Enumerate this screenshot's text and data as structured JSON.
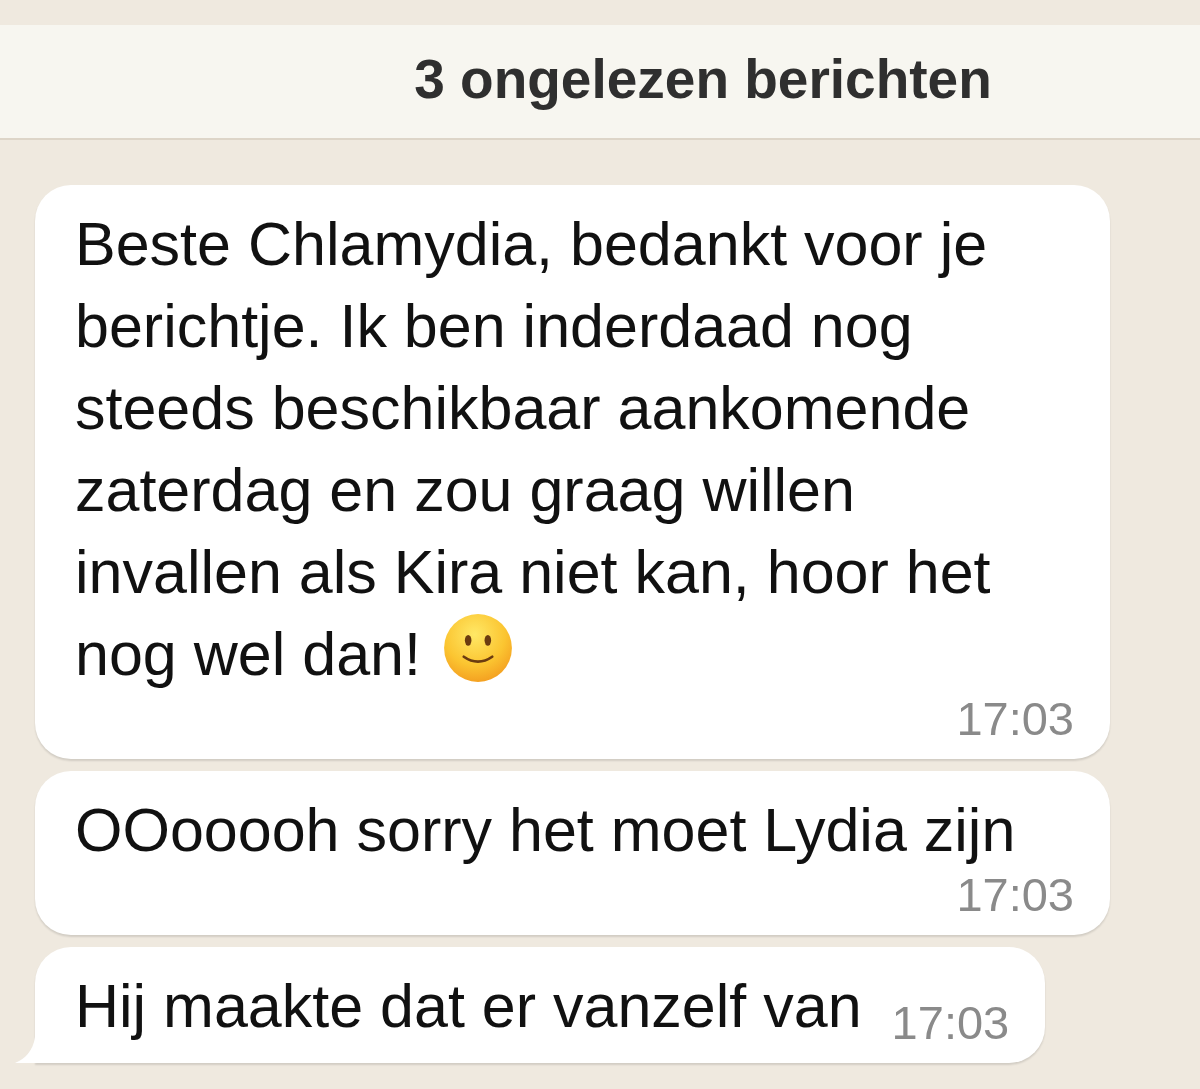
{
  "banner": {
    "text": "3 ongelezen berichten"
  },
  "messages": [
    {
      "text": "Beste Chlamydia, bedankt voor je berichtje. Ik ben inderdaad nog steeds beschikbaar aankomende zaterdag en zou graag willen invallen als Kira niet kan, hoor het nog wel dan!",
      "trailing_emoji": true,
      "time": "17:03",
      "tail": false
    },
    {
      "text": "OOooooh sorry het moet Lydia zijn",
      "trailing_emoji": false,
      "time": "17:03",
      "tail": false
    },
    {
      "text": "Hij maakte dat er vanzelf van",
      "trailing_emoji": false,
      "time": "17:03",
      "tail": true
    }
  ]
}
